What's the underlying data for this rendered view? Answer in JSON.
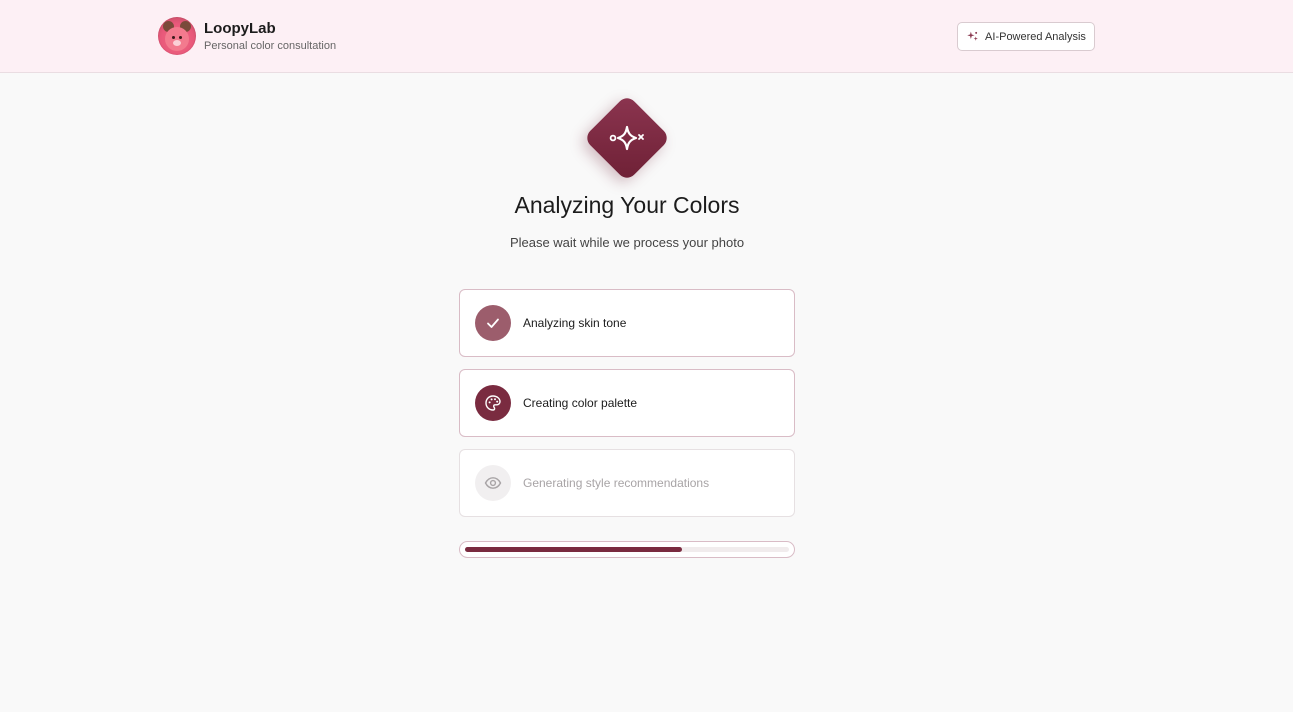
{
  "header": {
    "brand_name": "LoopyLab",
    "brand_subtitle": "Personal color consultation",
    "badge_label": "AI-Powered Analysis",
    "badge_icon": "sparkles-icon"
  },
  "main": {
    "title": "Analyzing Your Colors",
    "subtitle": "Please wait while we process your photo",
    "hero_icon": "sparkle-wand-icon",
    "steps": [
      {
        "label": "Analyzing skin tone",
        "status": "done",
        "icon": "check-icon"
      },
      {
        "label": "Creating color palette",
        "status": "active",
        "icon": "palette-icon"
      },
      {
        "label": "Generating style recommendations",
        "status": "pending",
        "icon": "eye-icon"
      }
    ],
    "progress_fraction": 0.67
  },
  "colors": {
    "accent": "#7a2b40",
    "done": "#9c5d6c",
    "header_bg": "#fdf0f5",
    "page_bg": "#f9f9f9"
  }
}
